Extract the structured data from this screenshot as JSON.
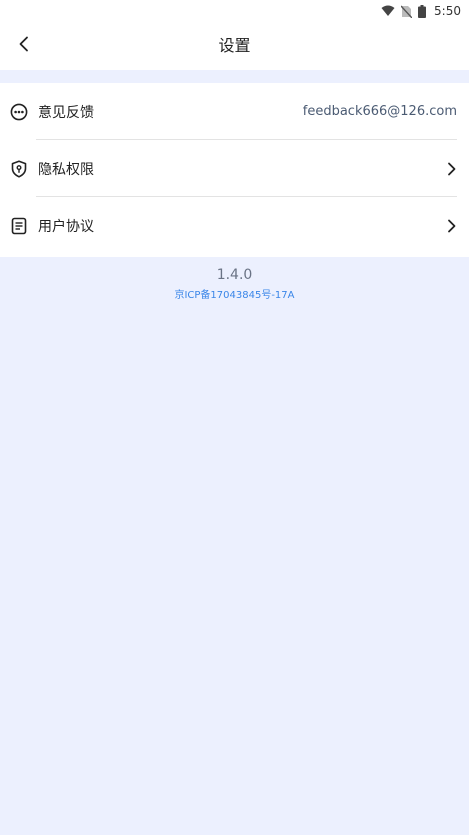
{
  "status_bar": {
    "time": "5:50",
    "icons": [
      "wifi-icon",
      "no-sim-icon",
      "battery-icon"
    ]
  },
  "header": {
    "title": "设置",
    "back_icon": "chevron-left-icon"
  },
  "settings": [
    {
      "label": "意见反馈",
      "value": "feedback666@126.com",
      "icon": "chat-bubble-icon"
    },
    {
      "label": "隐私权限",
      "icon": "shield-icon",
      "trailing": "chevron-right-icon"
    },
    {
      "label": "用户协议",
      "icon": "document-icon",
      "trailing": "chevron-right-icon"
    }
  ],
  "footer": {
    "version": "1.4.0",
    "icp": "京ICP备17043845号-17A"
  },
  "colors": {
    "background": "#ecf0fe",
    "surface": "#ffffff",
    "link": "#3a86e8"
  }
}
